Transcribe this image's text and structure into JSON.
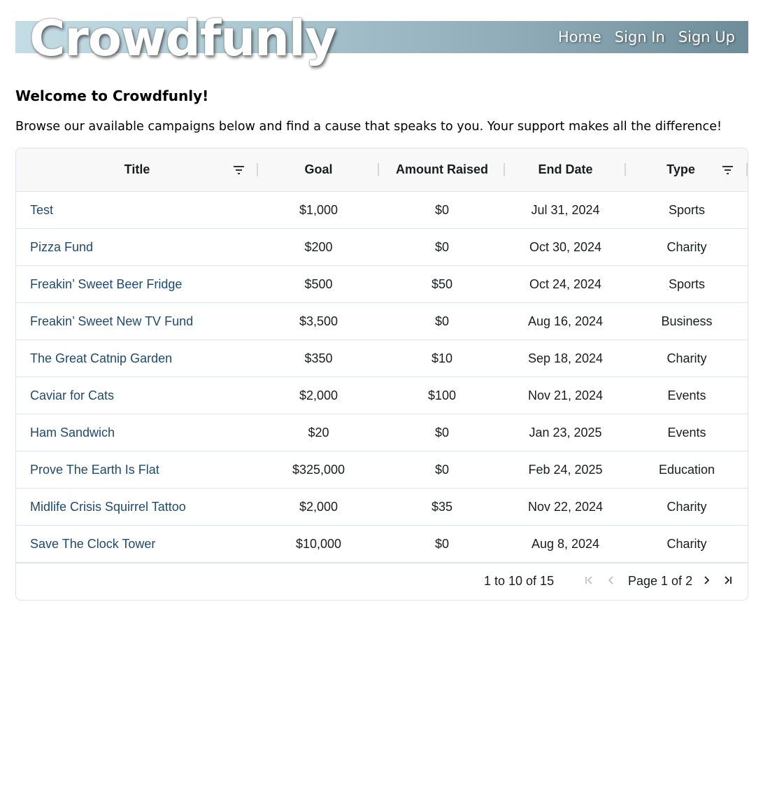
{
  "header": {
    "logo": "Crowdfunly",
    "nav": [
      "Home",
      "Sign In",
      "Sign Up"
    ]
  },
  "welcome": {
    "heading": "Welcome to Crowdfunly!",
    "intro": "Browse our available campaigns below and find a cause that speaks to you. Your support makes all the difference!"
  },
  "table": {
    "columns": [
      "Title",
      "Goal",
      "Amount Raised",
      "End Date",
      "Type"
    ],
    "rows": [
      {
        "title": "Test",
        "goal": "$1,000",
        "raised": "$0",
        "end": "Jul 31, 2024",
        "type": "Sports"
      },
      {
        "title": "Pizza Fund",
        "goal": "$200",
        "raised": "$0",
        "end": "Oct 30, 2024",
        "type": "Charity"
      },
      {
        "title": "Freakin’ Sweet Beer Fridge",
        "goal": "$500",
        "raised": "$50",
        "end": "Oct 24, 2024",
        "type": "Sports"
      },
      {
        "title": "Freakin’ Sweet New TV Fund",
        "goal": "$3,500",
        "raised": "$0",
        "end": "Aug 16, 2024",
        "type": "Business"
      },
      {
        "title": "The Great Catnip Garden",
        "goal": "$350",
        "raised": "$10",
        "end": "Sep 18, 2024",
        "type": "Charity"
      },
      {
        "title": "Caviar for Cats",
        "goal": "$2,000",
        "raised": "$100",
        "end": "Nov 21, 2024",
        "type": "Events"
      },
      {
        "title": "Ham Sandwich",
        "goal": "$20",
        "raised": "$0",
        "end": "Jan 23, 2025",
        "type": "Events"
      },
      {
        "title": "Prove The Earth Is Flat",
        "goal": "$325,000",
        "raised": "$0",
        "end": "Feb 24, 2025",
        "type": "Education"
      },
      {
        "title": "Midlife Crisis Squirrel Tattoo",
        "goal": "$2,000",
        "raised": "$35",
        "end": "Nov 22, 2024",
        "type": "Charity"
      },
      {
        "title": "Save The Clock Tower",
        "goal": "$10,000",
        "raised": "$0",
        "end": "Aug 8, 2024",
        "type": "Charity"
      }
    ]
  },
  "pagination": {
    "summary": "1 to 10 of 15",
    "page_text": "Page 1 of 2",
    "icons": [
      "first-page-icon",
      "previous-page-icon",
      "next-page-icon",
      "last-page-icon"
    ]
  },
  "colors": {
    "link": "#1e4a6e",
    "banner_start": "#c4dde5",
    "banner_end": "#6e8c99"
  }
}
